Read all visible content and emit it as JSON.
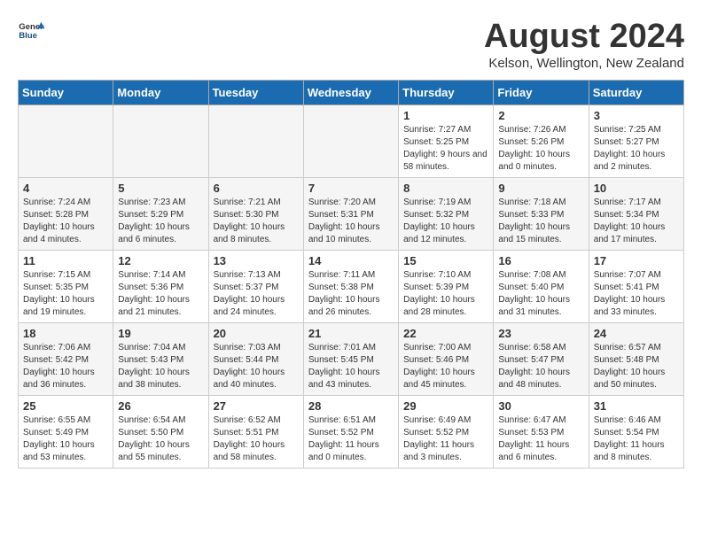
{
  "header": {
    "logo_general": "General",
    "logo_blue": "Blue",
    "month_year": "August 2024",
    "location": "Kelson, Wellington, New Zealand"
  },
  "weekdays": [
    "Sunday",
    "Monday",
    "Tuesday",
    "Wednesday",
    "Thursday",
    "Friday",
    "Saturday"
  ],
  "weeks": [
    [
      {
        "day": "",
        "empty": true
      },
      {
        "day": "",
        "empty": true
      },
      {
        "day": "",
        "empty": true
      },
      {
        "day": "",
        "empty": true
      },
      {
        "day": "1",
        "sunrise": "7:27 AM",
        "sunset": "5:25 PM",
        "daylight": "9 hours and 58 minutes."
      },
      {
        "day": "2",
        "sunrise": "7:26 AM",
        "sunset": "5:26 PM",
        "daylight": "10 hours and 0 minutes."
      },
      {
        "day": "3",
        "sunrise": "7:25 AM",
        "sunset": "5:27 PM",
        "daylight": "10 hours and 2 minutes."
      }
    ],
    [
      {
        "day": "4",
        "sunrise": "7:24 AM",
        "sunset": "5:28 PM",
        "daylight": "10 hours and 4 minutes."
      },
      {
        "day": "5",
        "sunrise": "7:23 AM",
        "sunset": "5:29 PM",
        "daylight": "10 hours and 6 minutes."
      },
      {
        "day": "6",
        "sunrise": "7:21 AM",
        "sunset": "5:30 PM",
        "daylight": "10 hours and 8 minutes."
      },
      {
        "day": "7",
        "sunrise": "7:20 AM",
        "sunset": "5:31 PM",
        "daylight": "10 hours and 10 minutes."
      },
      {
        "day": "8",
        "sunrise": "7:19 AM",
        "sunset": "5:32 PM",
        "daylight": "10 hours and 12 minutes."
      },
      {
        "day": "9",
        "sunrise": "7:18 AM",
        "sunset": "5:33 PM",
        "daylight": "10 hours and 15 minutes."
      },
      {
        "day": "10",
        "sunrise": "7:17 AM",
        "sunset": "5:34 PM",
        "daylight": "10 hours and 17 minutes."
      }
    ],
    [
      {
        "day": "11",
        "sunrise": "7:15 AM",
        "sunset": "5:35 PM",
        "daylight": "10 hours and 19 minutes."
      },
      {
        "day": "12",
        "sunrise": "7:14 AM",
        "sunset": "5:36 PM",
        "daylight": "10 hours and 21 minutes."
      },
      {
        "day": "13",
        "sunrise": "7:13 AM",
        "sunset": "5:37 PM",
        "daylight": "10 hours and 24 minutes."
      },
      {
        "day": "14",
        "sunrise": "7:11 AM",
        "sunset": "5:38 PM",
        "daylight": "10 hours and 26 minutes."
      },
      {
        "day": "15",
        "sunrise": "7:10 AM",
        "sunset": "5:39 PM",
        "daylight": "10 hours and 28 minutes."
      },
      {
        "day": "16",
        "sunrise": "7:08 AM",
        "sunset": "5:40 PM",
        "daylight": "10 hours and 31 minutes."
      },
      {
        "day": "17",
        "sunrise": "7:07 AM",
        "sunset": "5:41 PM",
        "daylight": "10 hours and 33 minutes."
      }
    ],
    [
      {
        "day": "18",
        "sunrise": "7:06 AM",
        "sunset": "5:42 PM",
        "daylight": "10 hours and 36 minutes."
      },
      {
        "day": "19",
        "sunrise": "7:04 AM",
        "sunset": "5:43 PM",
        "daylight": "10 hours and 38 minutes."
      },
      {
        "day": "20",
        "sunrise": "7:03 AM",
        "sunset": "5:44 PM",
        "daylight": "10 hours and 40 minutes."
      },
      {
        "day": "21",
        "sunrise": "7:01 AM",
        "sunset": "5:45 PM",
        "daylight": "10 hours and 43 minutes."
      },
      {
        "day": "22",
        "sunrise": "7:00 AM",
        "sunset": "5:46 PM",
        "daylight": "10 hours and 45 minutes."
      },
      {
        "day": "23",
        "sunrise": "6:58 AM",
        "sunset": "5:47 PM",
        "daylight": "10 hours and 48 minutes."
      },
      {
        "day": "24",
        "sunrise": "6:57 AM",
        "sunset": "5:48 PM",
        "daylight": "10 hours and 50 minutes."
      }
    ],
    [
      {
        "day": "25",
        "sunrise": "6:55 AM",
        "sunset": "5:49 PM",
        "daylight": "10 hours and 53 minutes."
      },
      {
        "day": "26",
        "sunrise": "6:54 AM",
        "sunset": "5:50 PM",
        "daylight": "10 hours and 55 minutes."
      },
      {
        "day": "27",
        "sunrise": "6:52 AM",
        "sunset": "5:51 PM",
        "daylight": "10 hours and 58 minutes."
      },
      {
        "day": "28",
        "sunrise": "6:51 AM",
        "sunset": "5:52 PM",
        "daylight": "11 hours and 0 minutes."
      },
      {
        "day": "29",
        "sunrise": "6:49 AM",
        "sunset": "5:52 PM",
        "daylight": "11 hours and 3 minutes."
      },
      {
        "day": "30",
        "sunrise": "6:47 AM",
        "sunset": "5:53 PM",
        "daylight": "11 hours and 6 minutes."
      },
      {
        "day": "31",
        "sunrise": "6:46 AM",
        "sunset": "5:54 PM",
        "daylight": "11 hours and 8 minutes."
      }
    ]
  ],
  "labels": {
    "sunrise": "Sunrise:",
    "sunset": "Sunset:",
    "daylight": "Daylight:"
  }
}
